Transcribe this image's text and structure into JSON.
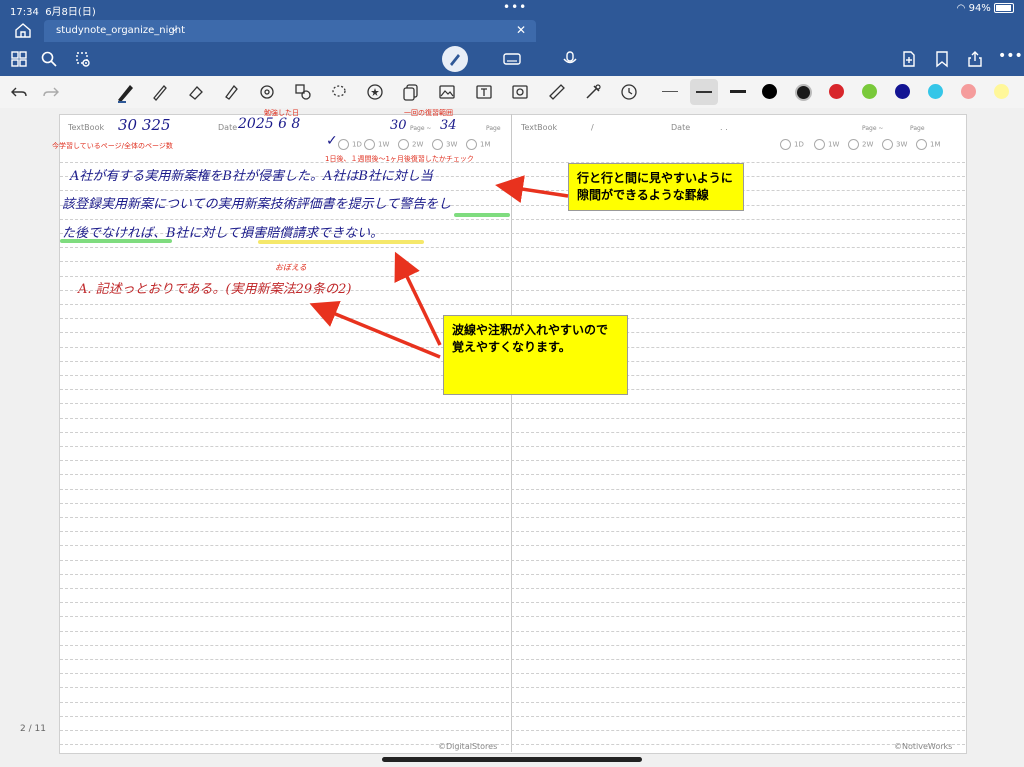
{
  "status": {
    "time": "17:34",
    "date": "6月8日(日)",
    "dots": "•••",
    "battery": "94%"
  },
  "tab": {
    "name": "studynote_organize_night",
    "chevron": "⌄",
    "close": "✕"
  },
  "toolbar": {
    "icons": [
      "grid-icon",
      "search-icon",
      "lasso-settings-icon",
      "pen-icon",
      "keyboard-icon",
      "mic-icon",
      "add-page-icon",
      "bookmark-icon",
      "share-icon",
      "more-icon"
    ],
    "tools": [
      "undo-icon",
      "redo-icon",
      "fountain-pen-icon",
      "pencil-icon",
      "eraser-icon",
      "highlighter-icon",
      "shape-icon",
      "element-icon",
      "lasso-icon",
      "star-icon",
      "copy-icon",
      "image-icon",
      "text-icon",
      "camera-icon",
      "ruler-icon",
      "laser-icon",
      "clock-icon"
    ],
    "colors": [
      "#000000",
      "#1a1a1a",
      "#d8262b",
      "#79c93a",
      "#131493",
      "#35c6e8",
      "#f59c9c",
      "#fff79a"
    ],
    "more": "•••"
  },
  "left_page": {
    "textbook_label": "TextBook",
    "textbook_value": "30 325",
    "date_label": "Date",
    "date_value": "2025 6 8",
    "page_range_start": "30",
    "page_range_end": "34",
    "page_label": "Page ~",
    "page_label2": "Page",
    "review": [
      "1D",
      "1W",
      "2W",
      "3W",
      "1M"
    ],
    "note_studied_date": "勉強した日",
    "note_review_range": "一回の復習範囲",
    "note_pages": "今学習しているページ/全体のページ数",
    "note_review_check": "1日後、１週間後〜1ヶ月後復習したかチェック",
    "lines": [
      "A社が有する実用新案権をB社が侵害した。A社はB社に対し当",
      "該登録実用新案についての実用新案技術評価書を提示して警告をし",
      "た後でなければ、B社に対して損害賠償請求できない。"
    ],
    "answer": "A. 記述っとおりである。(実用新案法29条の2)",
    "answer_note": "おぼえる",
    "copyright": "©DigitalStores"
  },
  "right_page": {
    "textbook_label": "TextBook",
    "slash": "/",
    "date_label": "Date",
    "date_dots": ".    .",
    "page_label": "Page ~",
    "page_label2": "Page",
    "review": [
      "1D",
      "1W",
      "2W",
      "3W",
      "1M"
    ],
    "copyright": "©NotiveWorks"
  },
  "callouts": {
    "top": "行と行と間に見やすいように隙間ができるような罫線",
    "bottom": "波線や注釈が入れやすいので覚えやすくなります。"
  },
  "page_indicator": "2 / 11"
}
